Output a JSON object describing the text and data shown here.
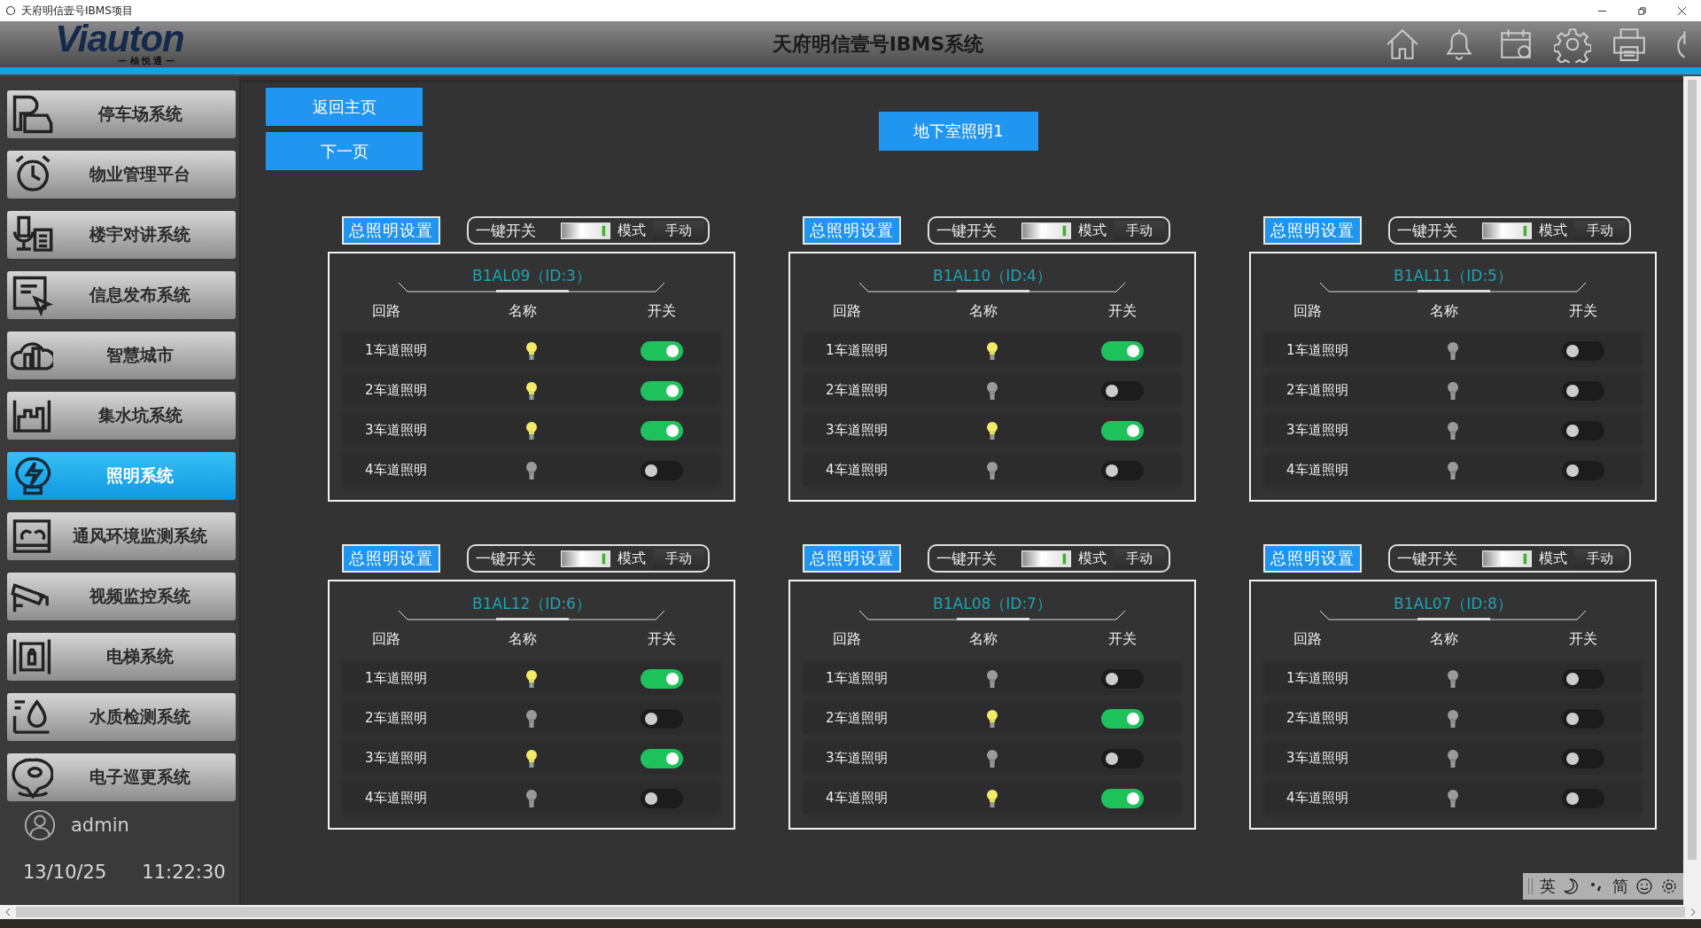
{
  "window": {
    "title": "天府明信壹号IBMS项目"
  },
  "header": {
    "logo": "Viauton",
    "logo_sub": "— 柚 悦 通 —",
    "title": "天府明信壹号IBMS系统"
  },
  "sidebar": {
    "items": [
      {
        "label": "停车场系统",
        "selected": false
      },
      {
        "label": "物业管理平台",
        "selected": false
      },
      {
        "label": "楼宇对讲系统",
        "selected": false
      },
      {
        "label": "信息发布系统",
        "selected": false
      },
      {
        "label": "智慧城市",
        "selected": false
      },
      {
        "label": "集水坑系统",
        "selected": false
      },
      {
        "label": "照明系统",
        "selected": true
      },
      {
        "label": "通风环境监测系统",
        "selected": false
      },
      {
        "label": "视频监控系统",
        "selected": false
      },
      {
        "label": "电梯系统",
        "selected": false
      },
      {
        "label": "水质检测系统",
        "selected": false
      },
      {
        "label": "电子巡更系统",
        "selected": false
      }
    ],
    "user": "admin",
    "date": "13/10/25",
    "time": "11:22:30"
  },
  "nav_buttons": [
    "返回主页",
    "下一页"
  ],
  "area_button": "地下室照明1",
  "panels": [
    {
      "settings_button": "总照明设置",
      "master_label": "一键开关",
      "mode_label": "模式",
      "mode_value": "手动",
      "title": "B1AL09（ID:3）",
      "columns": [
        "回路",
        "名称",
        "开关"
      ],
      "circuits": [
        {
          "name": "1车道照明",
          "on": true
        },
        {
          "name": "2车道照明",
          "on": true
        },
        {
          "name": "3车道照明",
          "on": true
        },
        {
          "name": "4车道照明",
          "on": false
        }
      ]
    },
    {
      "settings_button": "总照明设置",
      "master_label": "一键开关",
      "mode_label": "模式",
      "mode_value": "手动",
      "title": "B1AL10（ID:4）",
      "columns": [
        "回路",
        "名称",
        "开关"
      ],
      "circuits": [
        {
          "name": "1车道照明",
          "on": true
        },
        {
          "name": "2车道照明",
          "on": false
        },
        {
          "name": "3车道照明",
          "on": true
        },
        {
          "name": "4车道照明",
          "on": false
        }
      ]
    },
    {
      "settings_button": "总照明设置",
      "master_label": "一键开关",
      "mode_label": "模式",
      "mode_value": "手动",
      "title": "B1AL11（ID:5）",
      "columns": [
        "回路",
        "名称",
        "开关"
      ],
      "circuits": [
        {
          "name": "1车道照明",
          "on": false
        },
        {
          "name": "2车道照明",
          "on": false
        },
        {
          "name": "3车道照明",
          "on": false
        },
        {
          "name": "4车道照明",
          "on": false
        }
      ]
    },
    {
      "settings_button": "总照明设置",
      "master_label": "一键开关",
      "mode_label": "模式",
      "mode_value": "手动",
      "title": "B1AL12（ID:6）",
      "columns": [
        "回路",
        "名称",
        "开关"
      ],
      "circuits": [
        {
          "name": "1车道照明",
          "on": true
        },
        {
          "name": "2车道照明",
          "on": false
        },
        {
          "name": "3车道照明",
          "on": true
        },
        {
          "name": "4车道照明",
          "on": false
        }
      ]
    },
    {
      "settings_button": "总照明设置",
      "master_label": "一键开关",
      "mode_label": "模式",
      "mode_value": "手动",
      "title": "B1AL08（ID:7）",
      "columns": [
        "回路",
        "名称",
        "开关"
      ],
      "circuits": [
        {
          "name": "1车道照明",
          "on": false
        },
        {
          "name": "2车道照明",
          "on": true
        },
        {
          "name": "3车道照明",
          "on": false
        },
        {
          "name": "4车道照明",
          "on": true
        }
      ]
    },
    {
      "settings_button": "总照明设置",
      "master_label": "一键开关",
      "mode_label": "模式",
      "mode_value": "手动",
      "title": "B1AL07（ID:8）",
      "columns": [
        "回路",
        "名称",
        "开关"
      ],
      "circuits": [
        {
          "name": "1车道照明",
          "on": false
        },
        {
          "name": "2车道照明",
          "on": false
        },
        {
          "name": "3车道照明",
          "on": false
        },
        {
          "name": "4车道照明",
          "on": false
        }
      ]
    }
  ],
  "ime_bar": {
    "items": [
      "英",
      "简"
    ]
  }
}
